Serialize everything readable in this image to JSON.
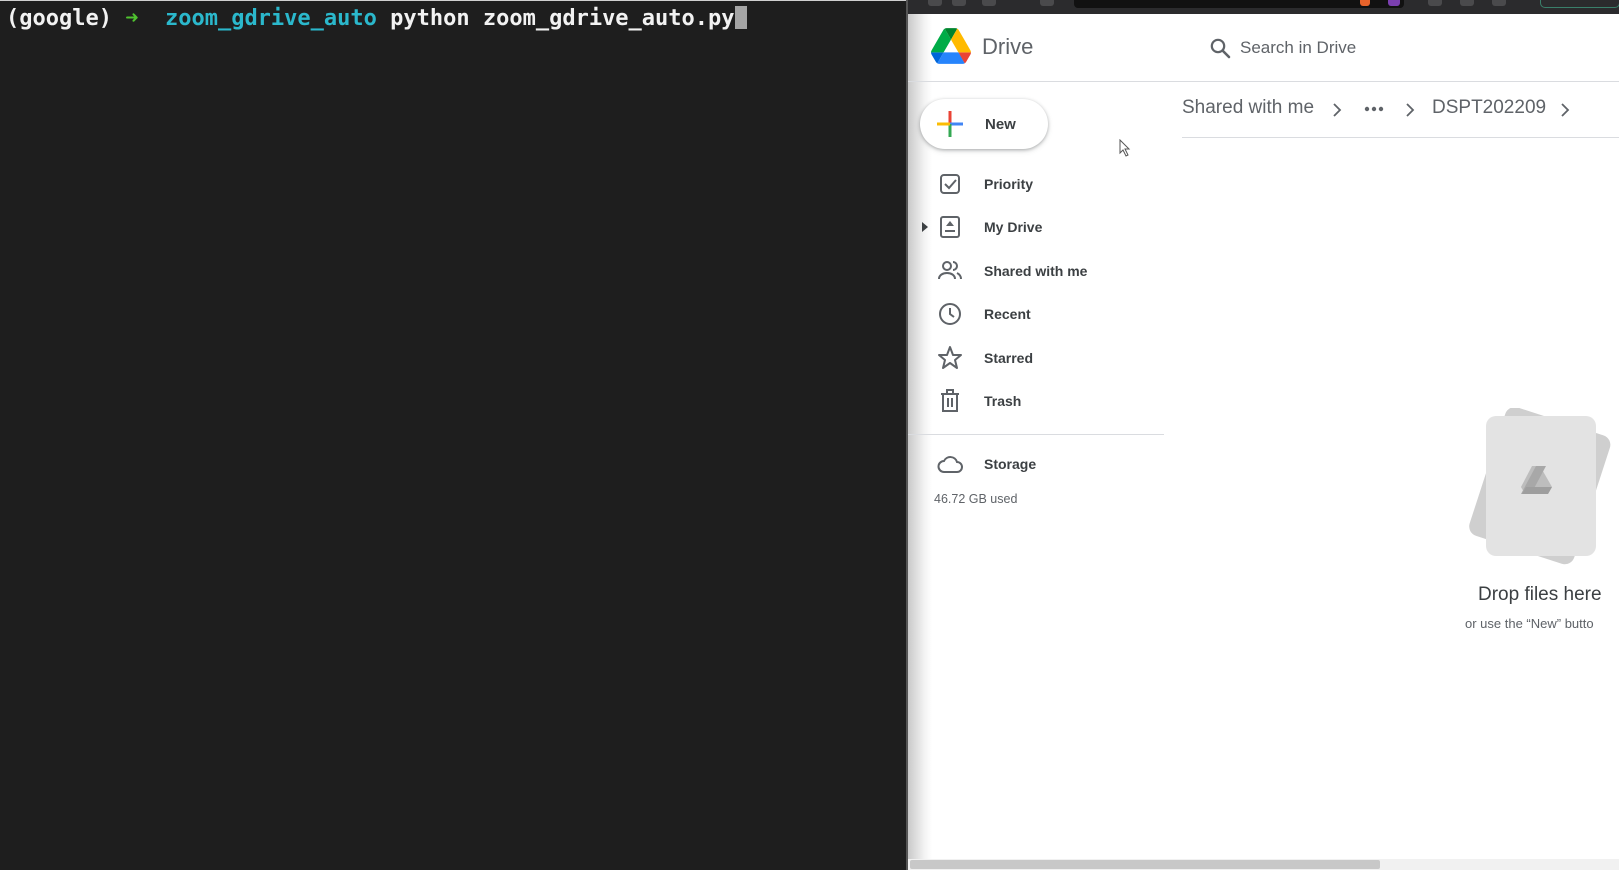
{
  "terminal": {
    "env": "(google)",
    "arrow": "➜",
    "dir": "zoom_gdrive_auto",
    "command": "python zoom_gdrive_auto.py"
  },
  "drive": {
    "app_title": "Drive",
    "search": {
      "placeholder": "Search in Drive",
      "value": ""
    },
    "new_button": "New",
    "nav": {
      "priority": "Priority",
      "my_drive": "My Drive",
      "shared_with_me": "Shared with me",
      "recent": "Recent",
      "starred": "Starred",
      "trash": "Trash"
    },
    "storage": {
      "label": "Storage",
      "used": "46.72 GB used"
    },
    "breadcrumb": {
      "root": "Shared with me",
      "current": "DSPT202209"
    },
    "empty_state": {
      "title": "Drop files here",
      "subtitle": "or use the “New” butto"
    }
  },
  "colors": {
    "terminal_bg": "#1e1e1e",
    "prompt_arrow": "#4fc12f",
    "prompt_dir": "#2bb8cc",
    "drive_text": "#3c4043",
    "drive_muted": "#5f6368"
  }
}
